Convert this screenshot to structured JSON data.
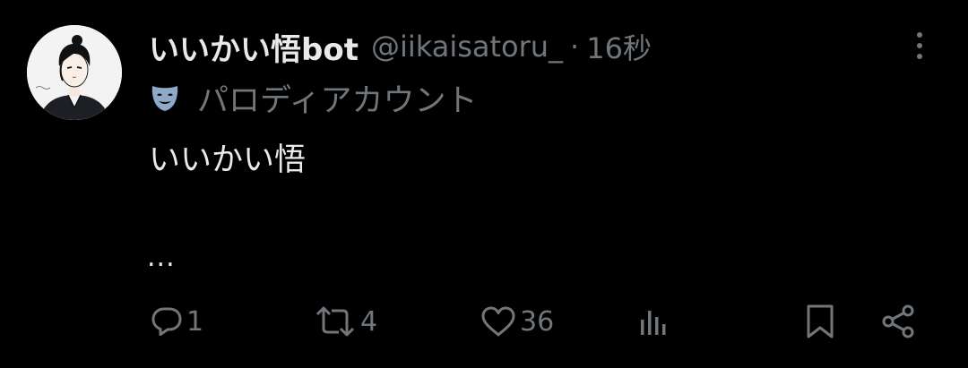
{
  "post": {
    "display_name": "いいかい悟bot",
    "handle": "@iikaisatoru_",
    "separator": "·",
    "time": "16秒",
    "label": "パロディアカウント",
    "text": "いいかい悟",
    "truncation": "..."
  },
  "actions": {
    "reply_count": "1",
    "repost_count": "4",
    "like_count": "36"
  },
  "icons": {
    "reply": "reply-icon",
    "repost": "repost-icon",
    "like": "heart-icon",
    "views": "views-icon",
    "bookmark": "bookmark-icon",
    "share": "share-icon",
    "more": "more-icon",
    "parody": "parody-mask-icon"
  },
  "colors": {
    "background": "#000000",
    "text": "#e7e9ea",
    "muted": "#71767b",
    "parody_mask": "#8ea8c8"
  }
}
